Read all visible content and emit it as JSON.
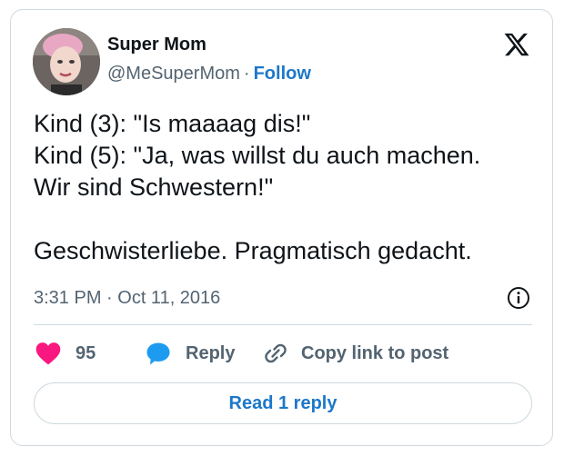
{
  "author": {
    "name": "Super Mom",
    "handle": "@MeSuperMom",
    "separator": "·",
    "follow_label": "Follow"
  },
  "tweet": {
    "lines": [
      "Kind (3): \"Is maaaag dis!\"",
      "Kind (5): \"Ja, was willst du auch machen.",
      "Wir sind Schwestern!\"",
      "",
      "Geschwisterliebe. Pragmatisch gedacht."
    ]
  },
  "meta": {
    "timestamp": "3:31 PM · Oct 11, 2016"
  },
  "actions": {
    "like_count": "95",
    "reply_label": "Reply",
    "copy_label": "Copy link to post"
  },
  "read_replies_label": "Read 1 reply",
  "icons": {
    "brand": "x-logo-icon",
    "like": "heart-icon",
    "reply": "speech-bubble-icon",
    "copy": "link-icon",
    "info": "info-icon"
  },
  "colors": {
    "heart": "#f91880",
    "reply_bubble": "#1d9bf0",
    "link": "#1d77c9",
    "muted": "#536471",
    "border": "#cfd9de"
  }
}
